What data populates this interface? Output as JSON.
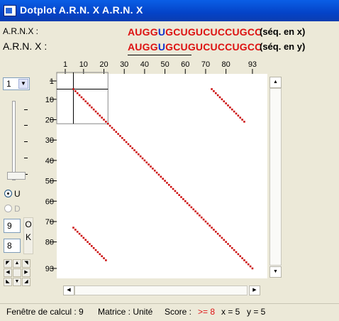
{
  "window": {
    "title": "Dotplot A.R.N. X A.R.N. X"
  },
  "sequences": {
    "x": {
      "label": "A.R.N.X :",
      "seq_part1": "AUGG",
      "seq_blue": "U",
      "seq_part2": "GCUGUCUCCUGCC",
      "desc": "(séq. en x)"
    },
    "y": {
      "label": "A.R.N. X :",
      "seq_part1": "AUGG",
      "seq_blue": "U",
      "seq_part2": "GCUGUCUCCUGCC",
      "desc": "(séq. en y)"
    }
  },
  "controls": {
    "select_value": "1",
    "slider_level": 1.0,
    "radio_u": "U",
    "radio_d": "D",
    "radio_selected": "U",
    "field1": "9",
    "field2": "8",
    "ok_label_1": "O",
    "ok_label_2": "K"
  },
  "icons": {
    "dropdown": "chevron-down-icon",
    "scroll_up": "triangle-up-icon",
    "scroll_down": "triangle-down-icon",
    "scroll_left": "triangle-left-icon",
    "scroll_right": "triangle-right-icon"
  },
  "chart_data": {
    "type": "scatter",
    "x_ticks": [
      "1",
      "10",
      "20",
      "30",
      "40",
      "50",
      "60",
      "70",
      "80",
      "93"
    ],
    "y_ticks": [
      "1",
      "10",
      "20",
      "30",
      "40",
      "50",
      "60",
      "70",
      "80",
      "93"
    ],
    "xlim": [
      1,
      93
    ],
    "ylim": [
      1,
      93
    ],
    "window": {
      "x_start": 1,
      "x_end": 22,
      "y_start": 1,
      "y_end": 22,
      "cursor_x": 5,
      "cursor_y": 5
    },
    "dot_color": "#cc1111",
    "series": [
      {
        "x_start": 5,
        "y_start": 5,
        "length": 89
      },
      {
        "x_start": 73,
        "y_start": 5,
        "length": 17
      },
      {
        "x_start": 5,
        "y_start": 73,
        "length": 17
      }
    ]
  },
  "status": {
    "fenetre": "Fenêtre de calcul : 9",
    "matrice": "Matrice : Unité",
    "score_label": "Score :",
    "score_value": ">= 8",
    "x": "x = 5",
    "y": "y = 5"
  }
}
